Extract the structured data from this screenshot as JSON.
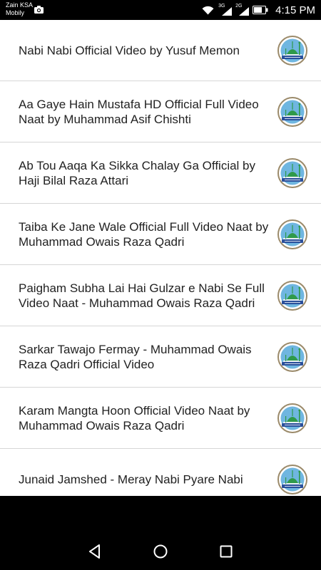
{
  "status_bar": {
    "carrier_line1": "Zain KSA",
    "carrier_line2": "Mobily",
    "network1": "3G",
    "network2": "2G",
    "time": "4:15 PM",
    "icons": [
      "camera-icon",
      "wifi-icon",
      "signal-icon",
      "battery-icon"
    ]
  },
  "videos": [
    {
      "title": "Nabi Nabi Official Video by Yusuf Memon"
    },
    {
      "title": "Aa Gaye Hain Mustafa HD Official Full Video Naat by Muhammad Asif Chishti"
    },
    {
      "title": "Ab Tou Aaqa Ka Sikka Chalay Ga Official by Haji Bilal Raza Attari"
    },
    {
      "title": "Taiba Ke Jane Wale Official Full Video Naat by Muhammad Owais Raza Qadri"
    },
    {
      "title": "Paigham Subha Lai Hai Gulzar e Nabi Se Full Video Naat - Muhammad Owais Raza Qadri"
    },
    {
      "title": "Sarkar Tawajo Fermay - Muhammad Owais Raza Qadri Official Video"
    },
    {
      "title": "Karam Mangta Hoon Official Video Naat by Muhammad Owais Raza Qadri"
    },
    {
      "title": "Junaid Jamshed -  Meray Nabi Pyare Nabi"
    }
  ],
  "thumbnail": {
    "icon": "mosque-dome-thumbnail-icon",
    "ring_color": "#9b8a6a",
    "sky_color": "#6fb6e0",
    "dome_color": "#2f9a4a",
    "banner_color": "#2a4f9a"
  },
  "nav_bar": {
    "back_icon": "back-triangle-icon",
    "home_icon": "home-circle-icon",
    "recents_icon": "recents-square-icon"
  }
}
